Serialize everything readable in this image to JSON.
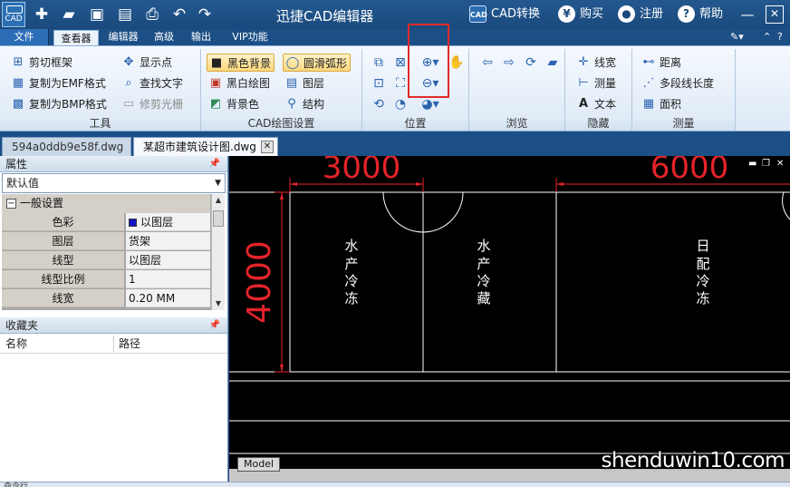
{
  "app": {
    "title": "迅捷CAD编辑器",
    "logo_text": "CAD"
  },
  "quick_access": [
    "new-icon",
    "open-icon",
    "save-icon",
    "save-as-icon",
    "print-icon",
    "undo-icon",
    "redo-icon"
  ],
  "title_right": {
    "convert": "CAD转换",
    "buy": "购买",
    "register": "注册",
    "help": "帮助",
    "convert_icon_text": "CAD",
    "buy_icon_text": "¥",
    "help_icon_text": "?"
  },
  "menu_tabs": [
    "文件",
    "查看器",
    "编辑器",
    "高级",
    "输出",
    "VIP功能"
  ],
  "ribbon": {
    "tools": {
      "label": "工具",
      "clip_frame": "剪切框架",
      "copy_emf": "复制为EMF格式",
      "copy_bmp": "复制为BMP格式",
      "show_points": "显示点",
      "find_text": "查找文字",
      "trim_raster": "修剪光栅"
    },
    "draw_settings": {
      "label": "CAD绘图设置",
      "black_bg": "黑色背景",
      "smooth_arc": "圆滑弧形",
      "bw_draw": "黑白绘图",
      "layers": "图层",
      "bg_color": "背景色",
      "structure": "结构"
    },
    "position": {
      "label": "位置"
    },
    "browse": {
      "label": "浏览"
    },
    "hide": {
      "label": "隐藏",
      "linewidth": "线宽",
      "measure": "测量",
      "text": "文本"
    },
    "measure": {
      "label": "测量",
      "distance": "距离",
      "polyline_length": "多段线长度",
      "area": "面积"
    }
  },
  "doc_tabs": [
    "594a0ddb9e58f.dwg",
    "某超市建筑设计图.dwg"
  ],
  "properties": {
    "title": "属性",
    "selector": "默认值",
    "section": "一般设置",
    "rows": [
      {
        "key": "色彩",
        "value": "以图层"
      },
      {
        "key": "图层",
        "value": "货架"
      },
      {
        "key": "线型",
        "value": "以图层"
      },
      {
        "key": "线型比例",
        "value": "1"
      },
      {
        "key": "线宽",
        "value": "0.20 MM"
      }
    ],
    "color_swatch": "#1414c8"
  },
  "favorites": {
    "title": "收藏夹",
    "col_name": "名称",
    "col_path": "路径"
  },
  "drawing": {
    "dim_3000": "3000",
    "dim_6000": "6000",
    "dim_4000": "4000",
    "room_1": [
      "水",
      "产",
      "冷",
      "冻"
    ],
    "room_2": [
      "水",
      "产",
      "冷",
      "藏"
    ],
    "room_3": [
      "日",
      "配",
      "冷",
      "冻"
    ]
  },
  "model_tab": "Model",
  "status": "命令行",
  "watermark": "shenduwin10.com",
  "colors": {
    "accent": "#1c4f86",
    "dimension": "#e4232a",
    "highlight": "#e02a2a"
  }
}
